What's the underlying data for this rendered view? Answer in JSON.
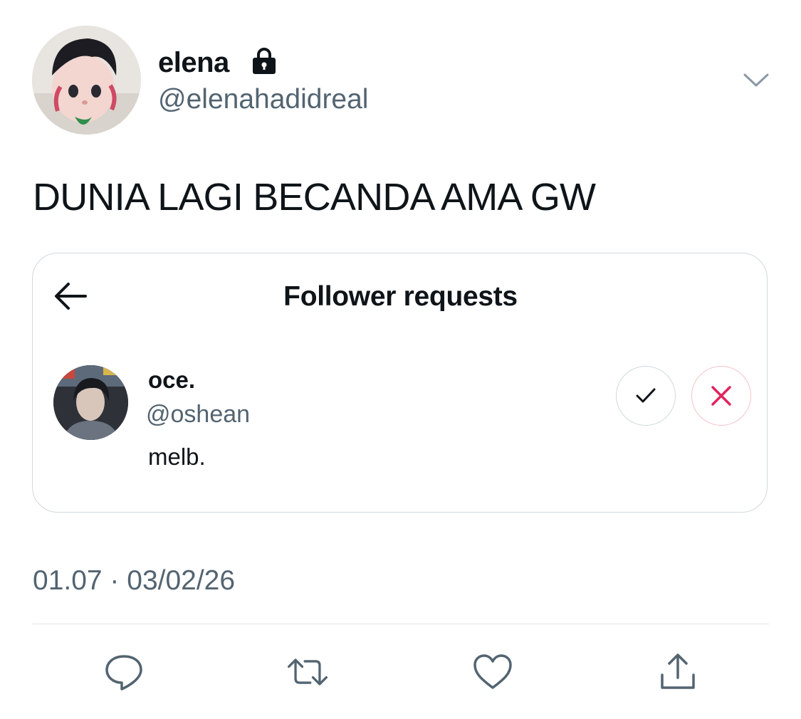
{
  "author": {
    "display_name": "elena",
    "handle": "@elenahadidreal",
    "locked": true
  },
  "tweet": {
    "text": "DUNIA LAGI BECANDA AMA GW",
    "timestamp": "01.07 · 03/02/26"
  },
  "embedded_card": {
    "title": "Follower requests",
    "request": {
      "name": "oce.",
      "handle": "@oshean",
      "bio": "melb."
    }
  },
  "actions": [
    "reply",
    "retweet",
    "like",
    "share"
  ],
  "colors": {
    "text": "#0f1419",
    "secondary": "#536471",
    "border": "#cfd9de",
    "decline": "#e0245e"
  }
}
